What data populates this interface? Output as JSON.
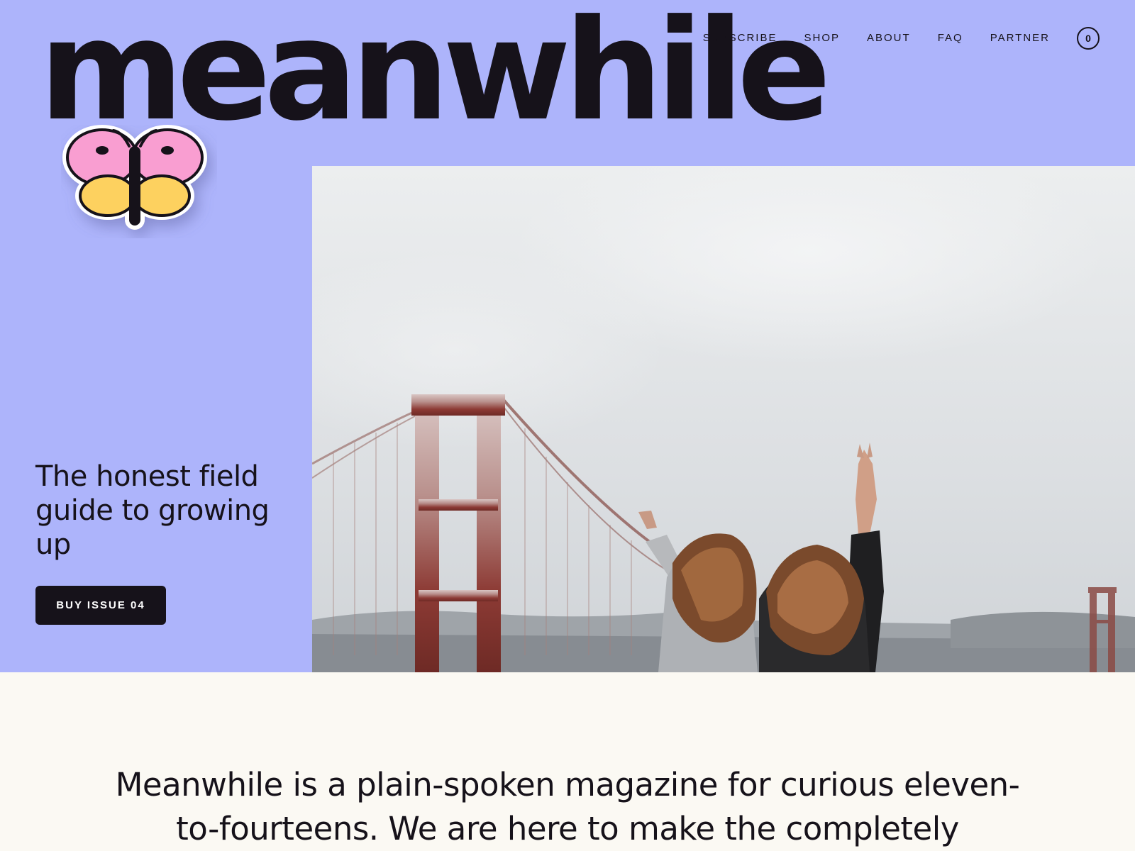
{
  "brand": {
    "name": "meanwhile",
    "background_color": "#adb4fb",
    "ink_color": "#16121a"
  },
  "nav": {
    "items": [
      {
        "label": "SUBSCRIBE"
      },
      {
        "label": "SHOP"
      },
      {
        "label": "ABOUT"
      },
      {
        "label": "FAQ"
      },
      {
        "label": "PARTNER"
      }
    ],
    "cart_count": "0"
  },
  "hero": {
    "mascot_icon": "butterfly-icon",
    "tagline": "The honest field guide to growing up",
    "cta_label": "BUY ISSUE 04",
    "photo": "two girls making peace signs in front of a foggy red suspension bridge"
  },
  "intro": {
    "text": "Meanwhile is a plain-spoken magazine for curious eleven-to-fourteens. We are here to make the completely"
  }
}
